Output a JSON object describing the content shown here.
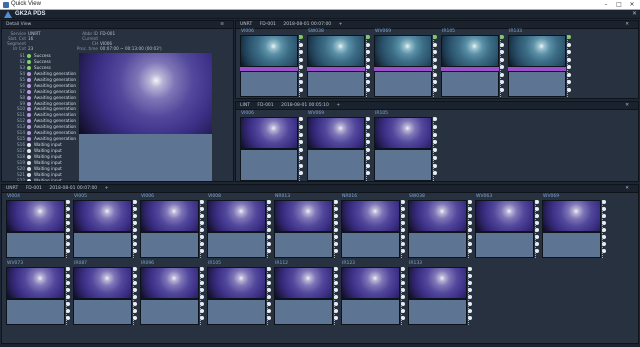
{
  "window": {
    "title": "Quick View"
  },
  "app": {
    "name": "GK2A PDS"
  },
  "detail": {
    "header": "Detail View",
    "service_k": "Service",
    "service_v": "UNIRT",
    "slot_k": "Slot. Cnt",
    "slot_v": "16",
    "seg_k": "Segment Ur Cnt",
    "seg_v": "23",
    "abbr_k": "Abbr ID",
    "abbr_v": "FD-001",
    "ch_k": "Current CH",
    "ch_v": "VI006",
    "time_k": "Proc. time",
    "time_v": "00:07:00 ~ 00:13:00 (00:03')",
    "steps": [
      {
        "no": "S1",
        "st": "Success"
      },
      {
        "no": "S2",
        "st": "Success"
      },
      {
        "no": "S3",
        "st": "Success"
      },
      {
        "no": "S4",
        "st": "Awaiting generation"
      },
      {
        "no": "S5",
        "st": "Awaiting generation"
      },
      {
        "no": "S6",
        "st": "Awaiting generation"
      },
      {
        "no": "S7",
        "st": "Awaiting generation"
      },
      {
        "no": "S8",
        "st": "Awaiting generation"
      },
      {
        "no": "S9",
        "st": "Awaiting generation"
      },
      {
        "no": "S10",
        "st": "Awaiting generation"
      },
      {
        "no": "S11",
        "st": "Awaiting generation"
      },
      {
        "no": "S12",
        "st": "Awaiting generation"
      },
      {
        "no": "S13",
        "st": "Awaiting generation"
      },
      {
        "no": "S14",
        "st": "Awaiting generation"
      },
      {
        "no": "S15",
        "st": "Awaiting generation"
      },
      {
        "no": "S16",
        "st": "Waiting input"
      },
      {
        "no": "S17",
        "st": "Waiting input"
      },
      {
        "no": "S18",
        "st": "Waiting input"
      },
      {
        "no": "S19",
        "st": "Waiting input"
      },
      {
        "no": "S20",
        "st": "Waiting input"
      },
      {
        "no": "S21",
        "st": "Waiting input"
      },
      {
        "no": "S22",
        "st": "Waiting input"
      }
    ]
  },
  "p1": {
    "svc": "UNRT",
    "id": "FD-001",
    "time": "2018-08-01 00:07:00",
    "add": "+",
    "channels": [
      "VI006",
      "SW038",
      "WV069",
      "IR105",
      "IR133"
    ]
  },
  "p2": {
    "svc": "LINT",
    "id": "FD-001",
    "time": "2018-08-01 00:05:10",
    "add": "+",
    "channels": [
      "VI006",
      "WV069",
      "IR105"
    ]
  },
  "p3": {
    "svc": "UNRT",
    "id": "FD-001",
    "time": "2018-08-01 00:07:00",
    "add": "+",
    "channels": [
      "VI004",
      "VI005",
      "VI006",
      "VI008",
      "NR013",
      "NR016",
      "SW038",
      "WV063",
      "WV069",
      "WV073",
      "IR087",
      "IR096",
      "IR105",
      "IR112",
      "IR123",
      "IR133"
    ]
  }
}
